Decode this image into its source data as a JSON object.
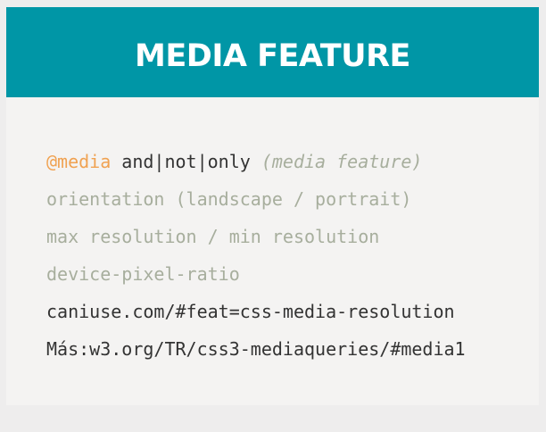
{
  "slide": {
    "title": "MEDIA FEATURE",
    "colors": {
      "header_bg": "#0096a6",
      "slide_bg": "#f4f3f2",
      "accent_orange": "#f0a252",
      "text_dark": "#333333",
      "text_muted": "#a7ae9d"
    },
    "lines": {
      "syntax": {
        "at_rule": "@media",
        "operators": " and|not|only ",
        "feature": "(media feature)"
      },
      "orientation": "orientation (landscape / portrait)",
      "resolution": "max resolution / min resolution",
      "pixel_ratio": "device-pixel-ratio",
      "caniuse": "caniuse.com/#feat=css-media-resolution",
      "more": "Más:w3.org/TR/css3-mediaqueries/#media1"
    }
  }
}
